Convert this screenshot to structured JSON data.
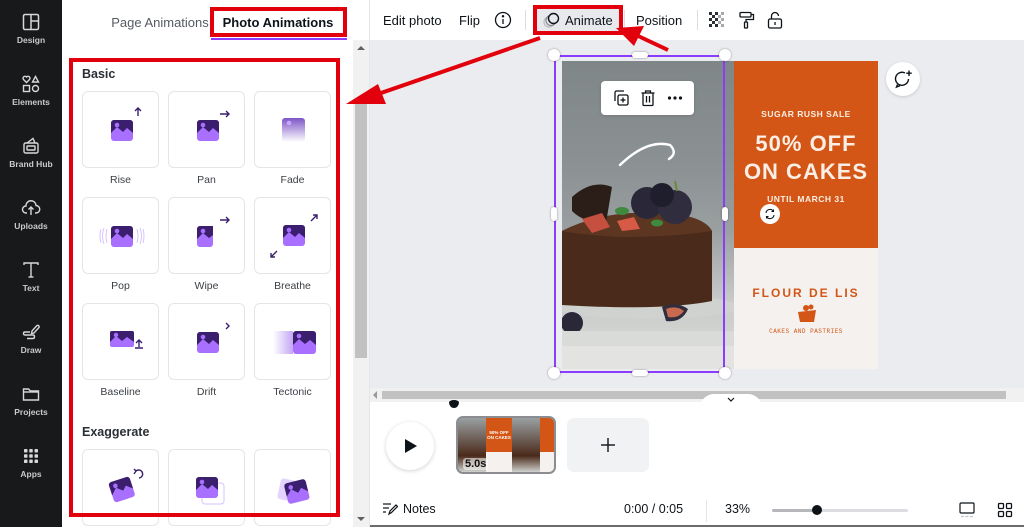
{
  "rail": {
    "items": [
      {
        "label": "Design",
        "icon": "layout-icon"
      },
      {
        "label": "Elements",
        "icon": "shapes-icon"
      },
      {
        "label": "Brand Hub",
        "icon": "brand-hub-icon"
      },
      {
        "label": "Uploads",
        "icon": "cloud-upload-icon"
      },
      {
        "label": "Text",
        "icon": "text-icon"
      },
      {
        "label": "Draw",
        "icon": "draw-icon"
      },
      {
        "label": "Projects",
        "icon": "folder-icon"
      },
      {
        "label": "Apps",
        "icon": "apps-grid-icon"
      }
    ]
  },
  "panel": {
    "tabs": [
      {
        "label": "Page Animations",
        "active": false
      },
      {
        "label": "Photo Animations",
        "active": true
      }
    ],
    "sections": [
      {
        "title": "Basic",
        "animations": [
          "Rise",
          "Pan",
          "Fade",
          "Pop",
          "Wipe",
          "Breathe",
          "Baseline",
          "Drift",
          "Tectonic"
        ]
      },
      {
        "title": "Exaggerate",
        "animations": [
          "Rotate",
          "Stack",
          "Tumble"
        ]
      }
    ]
  },
  "toolbar": {
    "edit_photo": "Edit photo",
    "flip": "Flip",
    "info_icon": "info-icon",
    "animate": "Animate",
    "position": "Position",
    "transparency_icon": "transparency-icon",
    "paint_roller_icon": "copy-style-icon",
    "lock_icon": "lock-icon"
  },
  "canvas": {
    "element_toolbar": [
      "duplicate-icon",
      "trash-icon",
      "more-icon"
    ],
    "poster": {
      "top_arc": "SUGAR RUSH SALE",
      "headline_1": "50% OFF",
      "headline_2": "ON CAKES",
      "bottom_arc": "UNTIL MARCH 31",
      "brand_arc": "FLOUR DE LIS",
      "brand_sub": "CAKES AND PASTRIES"
    },
    "colors": {
      "poster_orange": "#d35616",
      "poster_cream": "#f4f1ee",
      "selection": "#8b3dff",
      "annotation_red": "#e1000b"
    }
  },
  "timeline": {
    "clip_duration": "5.0s",
    "clip_thumb_text": "50% OFF ON CAKES",
    "add_page": "+"
  },
  "bottombar": {
    "notes": "Notes",
    "time": "0:00 / 0:05",
    "zoom": "33%",
    "zoom_level_fraction": 0.33
  }
}
